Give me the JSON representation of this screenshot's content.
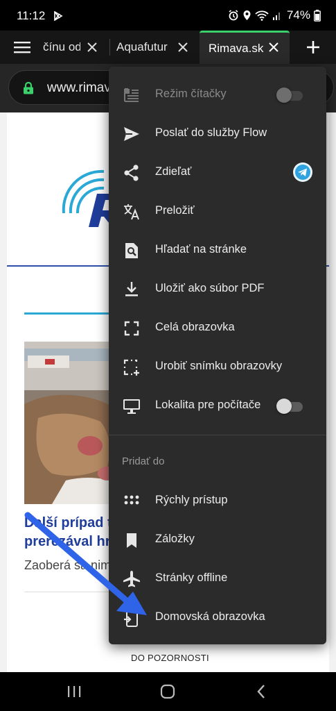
{
  "status_bar": {
    "time": "11:12",
    "battery": "74%"
  },
  "tabs": [
    {
      "title": "čínu od",
      "active": false
    },
    {
      "title": "Aquafutur",
      "active": false
    },
    {
      "title": "Rimava.sk",
      "active": true
    }
  ],
  "toolbar": {
    "url": "www.rimava.sk"
  },
  "page": {
    "headline_line1": "Ďalší prípad t",
    "headline_line2": "prerezával hr",
    "excerpt": "Zaoberá sa nim",
    "bottom_label": "DO POZORNOSTI"
  },
  "menu": {
    "items": [
      {
        "label": "Režim čítačky",
        "icon": "reader-mode-icon",
        "disabled": true,
        "toggle": "off"
      },
      {
        "label": "Poslať do služby Flow",
        "icon": "send-icon"
      },
      {
        "label": "Zdieľať",
        "icon": "share-icon",
        "badge": "telegram-icon"
      },
      {
        "label": "Preložiť",
        "icon": "translate-icon"
      },
      {
        "label": "Hľadať na stránke",
        "icon": "find-in-page-icon"
      },
      {
        "label": "Uložiť ako súbor PDF",
        "icon": "download-icon"
      },
      {
        "label": "Celá obrazovka",
        "icon": "fullscreen-icon"
      },
      {
        "label": "Urobiť snímku obrazovky",
        "icon": "screenshot-icon"
      },
      {
        "label": "Lokalita pre počítače",
        "icon": "desktop-icon",
        "toggle": "off"
      }
    ],
    "section_label": "Pridať do",
    "add_items": [
      {
        "label": "Rýchly prístup",
        "icon": "speed-dial-icon"
      },
      {
        "label": "Záložky",
        "icon": "bookmark-icon"
      },
      {
        "label": "Stránky offline",
        "icon": "airplane-icon"
      },
      {
        "label": "Domovská obrazovka",
        "icon": "add-to-home-icon"
      }
    ]
  },
  "colors": {
    "accent_tab": "#3bd06b",
    "menu_bg": "#2b2b2b",
    "annotation_arrow": "#2f63e8",
    "headline": "#1f3d9a"
  }
}
